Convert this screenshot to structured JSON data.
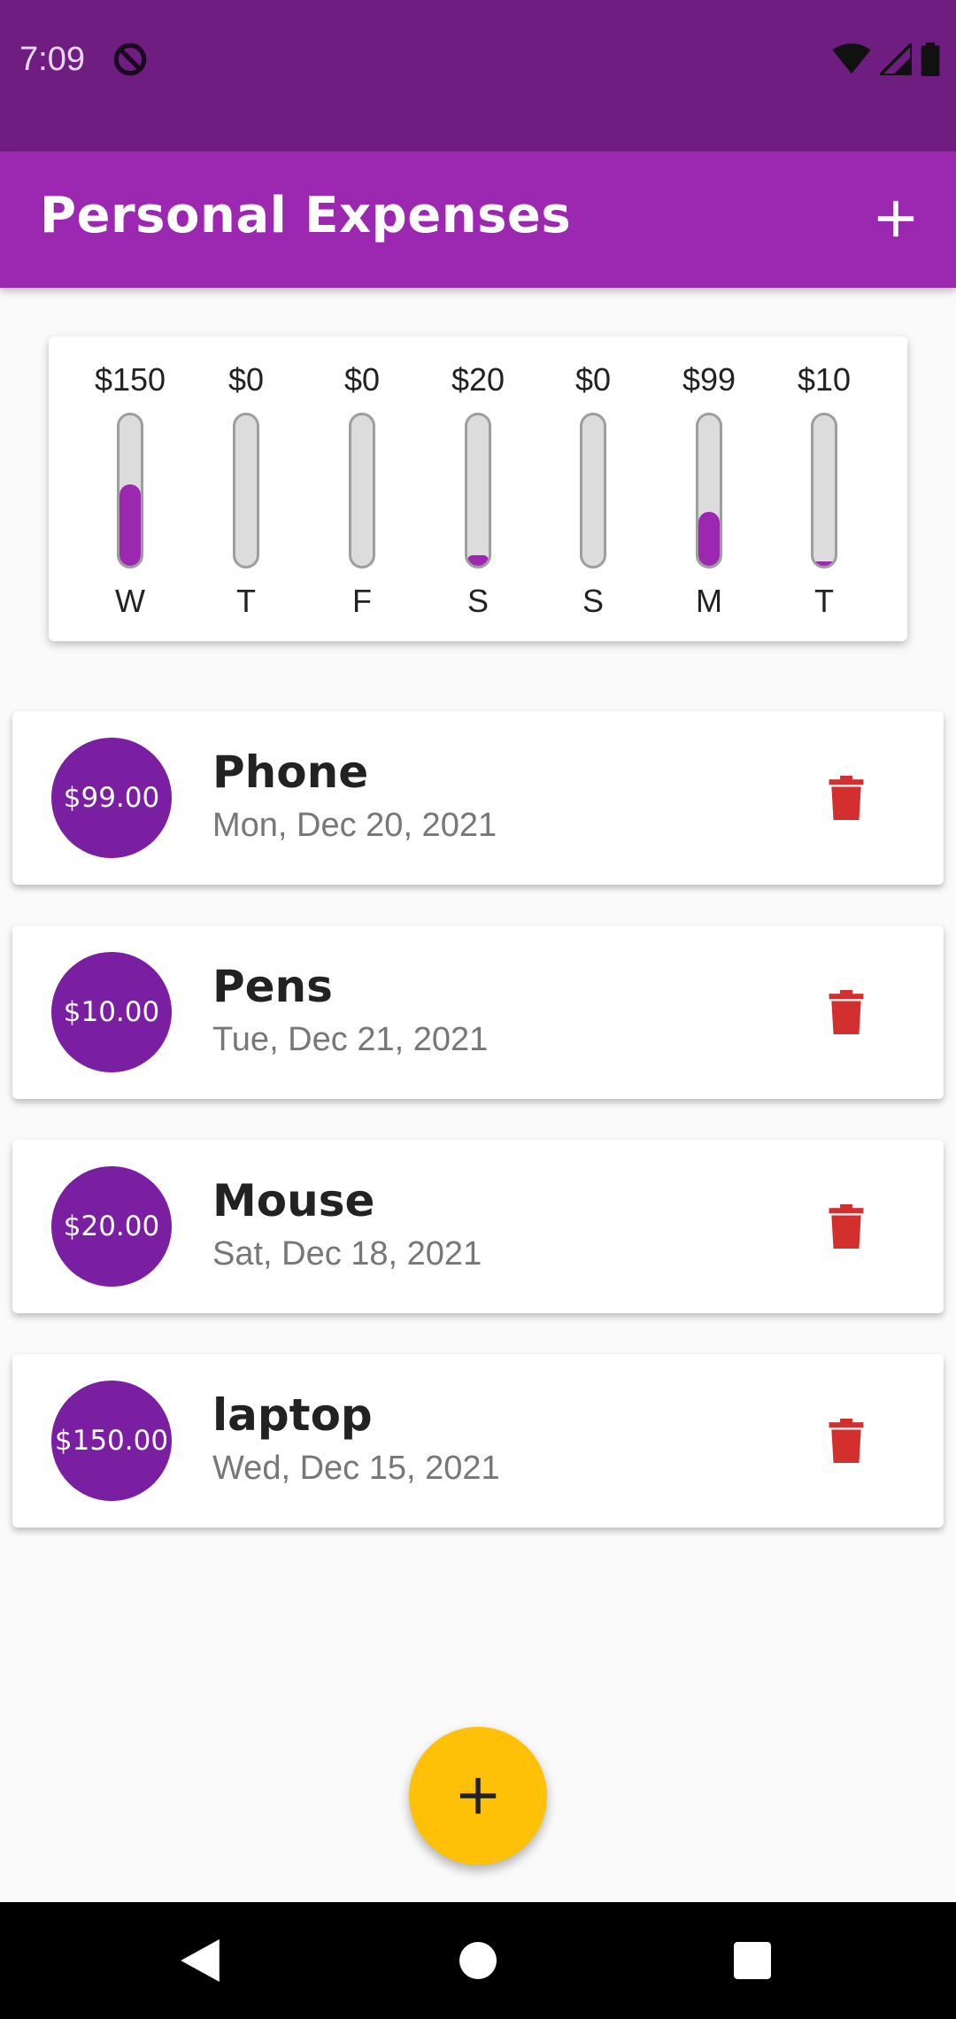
{
  "status_bar": {
    "time": "7:09",
    "icons": [
      "do-not-disturb-icon",
      "wifi-icon",
      "signal-icon",
      "battery-icon"
    ]
  },
  "app_bar": {
    "title": "Personal Expenses",
    "add_icon": "plus-icon"
  },
  "chart": {
    "bars": [
      {
        "day": "W",
        "amount": "$150",
        "fraction": 0.54
      },
      {
        "day": "T",
        "amount": "$0",
        "fraction": 0
      },
      {
        "day": "F",
        "amount": "$0",
        "fraction": 0
      },
      {
        "day": "S",
        "amount": "$20",
        "fraction": 0.07
      },
      {
        "day": "S",
        "amount": "$0",
        "fraction": 0
      },
      {
        "day": "M",
        "amount": "$99",
        "fraction": 0.36
      },
      {
        "day": "T",
        "amount": "$10",
        "fraction": 0.03
      }
    ],
    "fill_color": "#9c27b0"
  },
  "transactions": [
    {
      "amount": "$99.00",
      "title": "Phone",
      "date": "Mon, Dec 20, 2021"
    },
    {
      "amount": "$10.00",
      "title": "Pens",
      "date": "Tue, Dec 21, 2021"
    },
    {
      "amount": "$20.00",
      "title": "Mouse",
      "date": "Sat, Dec 18, 2021"
    },
    {
      "amount": "$150.00",
      "title": "laptop",
      "date": "Wed, Dec 15, 2021"
    }
  ],
  "colors": {
    "status_bar": "#6f1d81",
    "app_bar": "#9c27b0",
    "avatar": "#7b1fa2",
    "delete": "#d32f2f",
    "fab": "#ffc107"
  },
  "fab": {
    "icon": "plus-icon"
  },
  "nav_bar": {
    "icons": [
      "back-icon",
      "home-icon",
      "recents-icon"
    ]
  }
}
